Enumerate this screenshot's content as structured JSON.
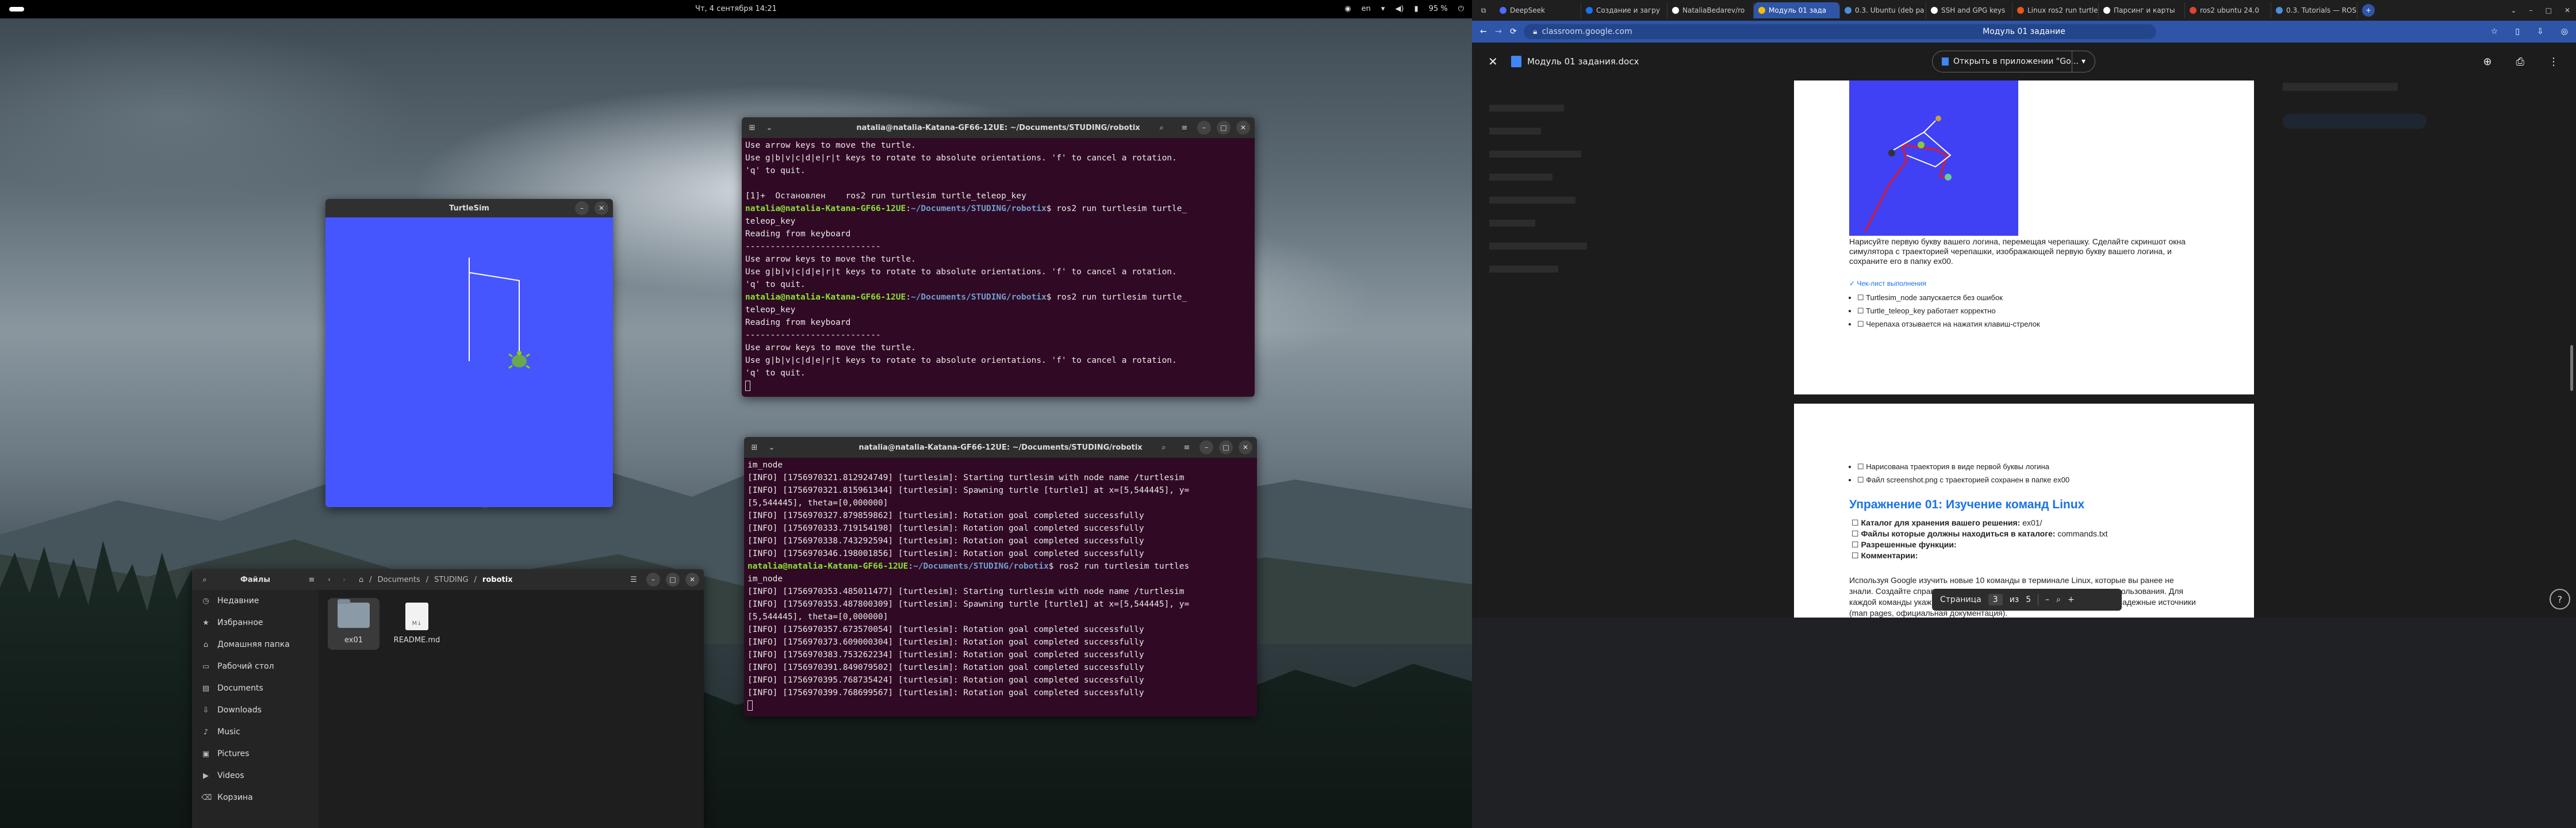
{
  "topbar": {
    "clock": "Чт, 4 сентября 14:21",
    "lang": "en",
    "battery": "95 %"
  },
  "turtlesim": {
    "title": "TurtleSim",
    "bg": "#4556ff"
  },
  "terminal1": {
    "title": "natalia@natalia-Katana-GF66-12UE: ~/Documents/STUDING/robotix",
    "lines": [
      [
        [
          "t",
          "Use arrow keys to move the turtle."
        ]
      ],
      [
        [
          "t",
          "Use g|b|v|c|d|e|r|t keys to rotate to absolute orientations. 'f' to cancel a rotation."
        ]
      ],
      [
        [
          "t",
          "'q' to quit."
        ]
      ],
      [
        [
          "t",
          ""
        ]
      ],
      [
        [
          "t",
          "[1]+  Остановлен    ros2 run turtlesim turtle_teleop_key"
        ]
      ],
      [
        [
          "pr",
          "natalia@natalia-Katana-GF66-12UE"
        ],
        [
          "t",
          ":"
        ],
        [
          "pa",
          "~/Documents/STUDING/robotix"
        ],
        [
          "t",
          "$ ros2 run turtlesim turtle_"
        ]
      ],
      [
        [
          "t",
          "teleop_key"
        ]
      ],
      [
        [
          "t",
          "Reading from keyboard"
        ]
      ],
      [
        [
          "t",
          "---------------------------"
        ]
      ],
      [
        [
          "t",
          "Use arrow keys to move the turtle."
        ]
      ],
      [
        [
          "t",
          "Use g|b|v|c|d|e|r|t keys to rotate to absolute orientations. 'f' to cancel a rotation."
        ]
      ],
      [
        [
          "t",
          "'q' to quit."
        ]
      ],
      [
        [
          "pr",
          "natalia@natalia-Katana-GF66-12UE"
        ],
        [
          "t",
          ":"
        ],
        [
          "pa",
          "~/Documents/STUDING/robotix"
        ],
        [
          "t",
          "$ ros2 run turtlesim turtle_"
        ]
      ],
      [
        [
          "t",
          "teleop_key"
        ]
      ],
      [
        [
          "t",
          "Reading from keyboard"
        ]
      ],
      [
        [
          "t",
          "---------------------------"
        ]
      ],
      [
        [
          "t",
          "Use arrow keys to move the turtle."
        ]
      ],
      [
        [
          "t",
          "Use g|b|v|c|d|e|r|t keys to rotate to absolute orientations. 'f' to cancel a rotation."
        ]
      ],
      [
        [
          "t",
          "'q' to quit."
        ]
      ]
    ]
  },
  "terminal2": {
    "title": "natalia@natalia-Katana-GF66-12UE: ~/Documents/STUDING/robotix",
    "lines": [
      [
        [
          "t",
          "im_node"
        ]
      ],
      [
        [
          "t",
          "[INFO] [1756970321.812924749] [turtlesim]: Starting turtlesim with node name /turtlesim"
        ]
      ],
      [
        [
          "t",
          "[INFO] [1756970321.815961344] [turtlesim]: Spawning turtle [turtle1] at x=[5,544445], y="
        ]
      ],
      [
        [
          "t",
          "[5,544445], theta=[0,000000]"
        ]
      ],
      [
        [
          "t",
          "[INFO] [1756970327.879859862] [turtlesim]: Rotation goal completed successfully"
        ]
      ],
      [
        [
          "t",
          "[INFO] [1756970333.719154198] [turtlesim]: Rotation goal completed successfully"
        ]
      ],
      [
        [
          "t",
          "[INFO] [1756970338.743292594] [turtlesim]: Rotation goal completed successfully"
        ]
      ],
      [
        [
          "t",
          "[INFO] [1756970346.198001856] [turtlesim]: Rotation goal completed successfully"
        ]
      ],
      [
        [
          "pr",
          "natalia@natalia-Katana-GF66-12UE"
        ],
        [
          "t",
          ":"
        ],
        [
          "pa",
          "~/Documents/STUDING/robotix"
        ],
        [
          "t",
          "$ ros2 run turtlesim turtles"
        ]
      ],
      [
        [
          "t",
          "im_node"
        ]
      ],
      [
        [
          "t",
          "[INFO] [1756970353.485011477] [turtlesim]: Starting turtlesim with node name /turtlesim"
        ]
      ],
      [
        [
          "t",
          "[INFO] [1756970353.487800309] [turtlesim]: Spawning turtle [turtle1] at x=[5,544445], y="
        ]
      ],
      [
        [
          "t",
          "[5,544445], theta=[0,000000]"
        ]
      ],
      [
        [
          "t",
          "[INFO] [1756970357.673570054] [turtlesim]: Rotation goal completed successfully"
        ]
      ],
      [
        [
          "t",
          "[INFO] [1756970373.609000304] [turtlesim]: Rotation goal completed successfully"
        ]
      ],
      [
        [
          "t",
          "[INFO] [1756970383.753262234] [turtlesim]: Rotation goal completed successfully"
        ]
      ],
      [
        [
          "t",
          "[INFO] [1756970391.849079502] [turtlesim]: Rotation goal completed successfully"
        ]
      ],
      [
        [
          "t",
          "[INFO] [1756970395.768735424] [turtlesim]: Rotation goal completed successfully"
        ]
      ],
      [
        [
          "t",
          "[INFO] [1756970399.768699567] [turtlesim]: Rotation goal completed successfully"
        ]
      ]
    ]
  },
  "files": {
    "title": "Файлы",
    "path": [
      "Documents",
      "STUDING",
      "robotix"
    ],
    "sidebar": [
      {
        "icon": "◷",
        "label": "Недавние"
      },
      {
        "icon": "★",
        "label": "Избранное"
      },
      {
        "icon": "⌂",
        "label": "Домашняя папка"
      },
      {
        "icon": "▭",
        "label": "Рабочий стол"
      },
      {
        "icon": "▤",
        "label": "Documents"
      },
      {
        "icon": "⇩",
        "label": "Downloads"
      },
      {
        "icon": "♪",
        "label": "Music"
      },
      {
        "icon": "▣",
        "label": "Pictures"
      },
      {
        "icon": "▶",
        "label": "Videos"
      },
      {
        "icon": "⌫",
        "label": "Корзина"
      }
    ],
    "items": [
      {
        "type": "folder",
        "label": "ex01"
      },
      {
        "type": "file",
        "label": "README.md"
      }
    ]
  },
  "browser": {
    "tabs": [
      {
        "label": "DeepSeek",
        "color": "#4d6bfe"
      },
      {
        "label": "Создание и загру",
        "color": "#1a73e8"
      },
      {
        "label": "NataliaBedarev/ro",
        "color": "#ffffff"
      },
      {
        "label": "Модуль 01 зада",
        "color": "#fbbc04",
        "active": true
      },
      {
        "label": "0.3. Ubuntu (deb pa",
        "color": "#4a90d9"
      },
      {
        "label": "SSH and GPG keys",
        "color": "#ffffff"
      },
      {
        "label": "Linux ros2 run turtlesim",
        "color": "#e2571e"
      },
      {
        "label": "Парсинг и карты",
        "color": "#ffffff"
      },
      {
        "label": "ros2 ubuntu 24.0",
        "color": "#db4437"
      },
      {
        "label": "0.3. Tutorials — ROS 2",
        "color": "#4a90d9"
      }
    ],
    "url": "classroom.google.com",
    "title": "Модуль 01 задание",
    "docname": "Модуль 01 задания.docx",
    "open_btn": "Открыть в приложении \"Go...",
    "page1": {
      "para": "Нарисуйте первую букву вашего логина, перемещая черепашку. Сделайте скриншот окна симулятора с траекторией черепашки, изображающей первую букву вашего логина, и сохраните его в папку ex00.",
      "checklist_title": "✓ Чек-лист выполнения",
      "checks": [
        "☐ Turtlesim_node запускается без ошибок",
        "☐ Turtle_teleop_key работает корректно",
        "☐ Черепаха отзывается на нажатия клавиш-стрелок"
      ]
    },
    "page2": {
      "checks": [
        "☐ Нарисована траектория в виде первой буквы логина",
        "☐ Файл screenshot.png с траекторией сохранен в папке ex00"
      ],
      "heading": "Упражнение 01: Изучение команд Linux",
      "fields": [
        {
          "k": "Каталог для хранения вашего решения:",
          "v": " ex01/"
        },
        {
          "k": "Файлы которые должны находиться в каталоге:",
          "v": " commands.txt"
        },
        {
          "k": "Разрешенные функции:",
          "v": ""
        },
        {
          "k": "Комментарии:",
          "v": ""
        }
      ],
      "para": "Используя Google изучить новые 10 команды в терминале Linux, которые вы ранее не знали. Создайте справочник: краткое описание, синтаксис, примеры использования. Для каждой команды укажите назначение, синтаксис, пример. Используйте надежные источники (man pages, официальная документация)."
    },
    "pager": {
      "label": "Страница",
      "current": "3",
      "sep": "из",
      "total": "5"
    }
  }
}
